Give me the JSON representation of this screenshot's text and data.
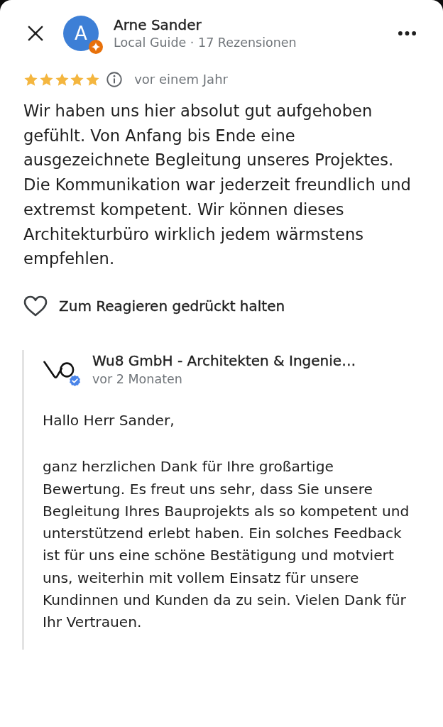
{
  "reviewer": {
    "initial": "A",
    "name": "Arne Sander",
    "subtitle": "Local Guide · 17 Rezensionen"
  },
  "review": {
    "stars": 5,
    "date": "vor einem Jahr",
    "text": "Wir haben uns hier absolut gut aufgehoben gefühlt. Von Anfang bis Ende eine ausgezeichnete Begleitung unseres Projektes. Die Kommunikation war jederzeit freundlich und extremst kompetent. Wir können dieses Architekturbüro wirklich jedem wärmstens empfehlen."
  },
  "reaction": {
    "label": "Zum Reagieren gedrückt halten"
  },
  "owner_reply": {
    "name": "Wu8 GmbH - Architekten & Ingenie…",
    "verified": true,
    "date": "vor 2 Monaten",
    "greeting": "Hallo Herr Sander,",
    "text": "ganz herzlichen Dank für Ihre großartige Bewertung. Es freut uns sehr, dass Sie unsere Begleitung Ihres Bauprojekts als so kompetent und unterstützend erlebt haben. Ein solches Feedback ist für uns eine schöne Bestätigung und motviert uns, weiterhin mit vollem Einsatz für unsere Kundinnen und Kunden da zu sein. Vielen Dank für Ihr Vertrauen."
  }
}
